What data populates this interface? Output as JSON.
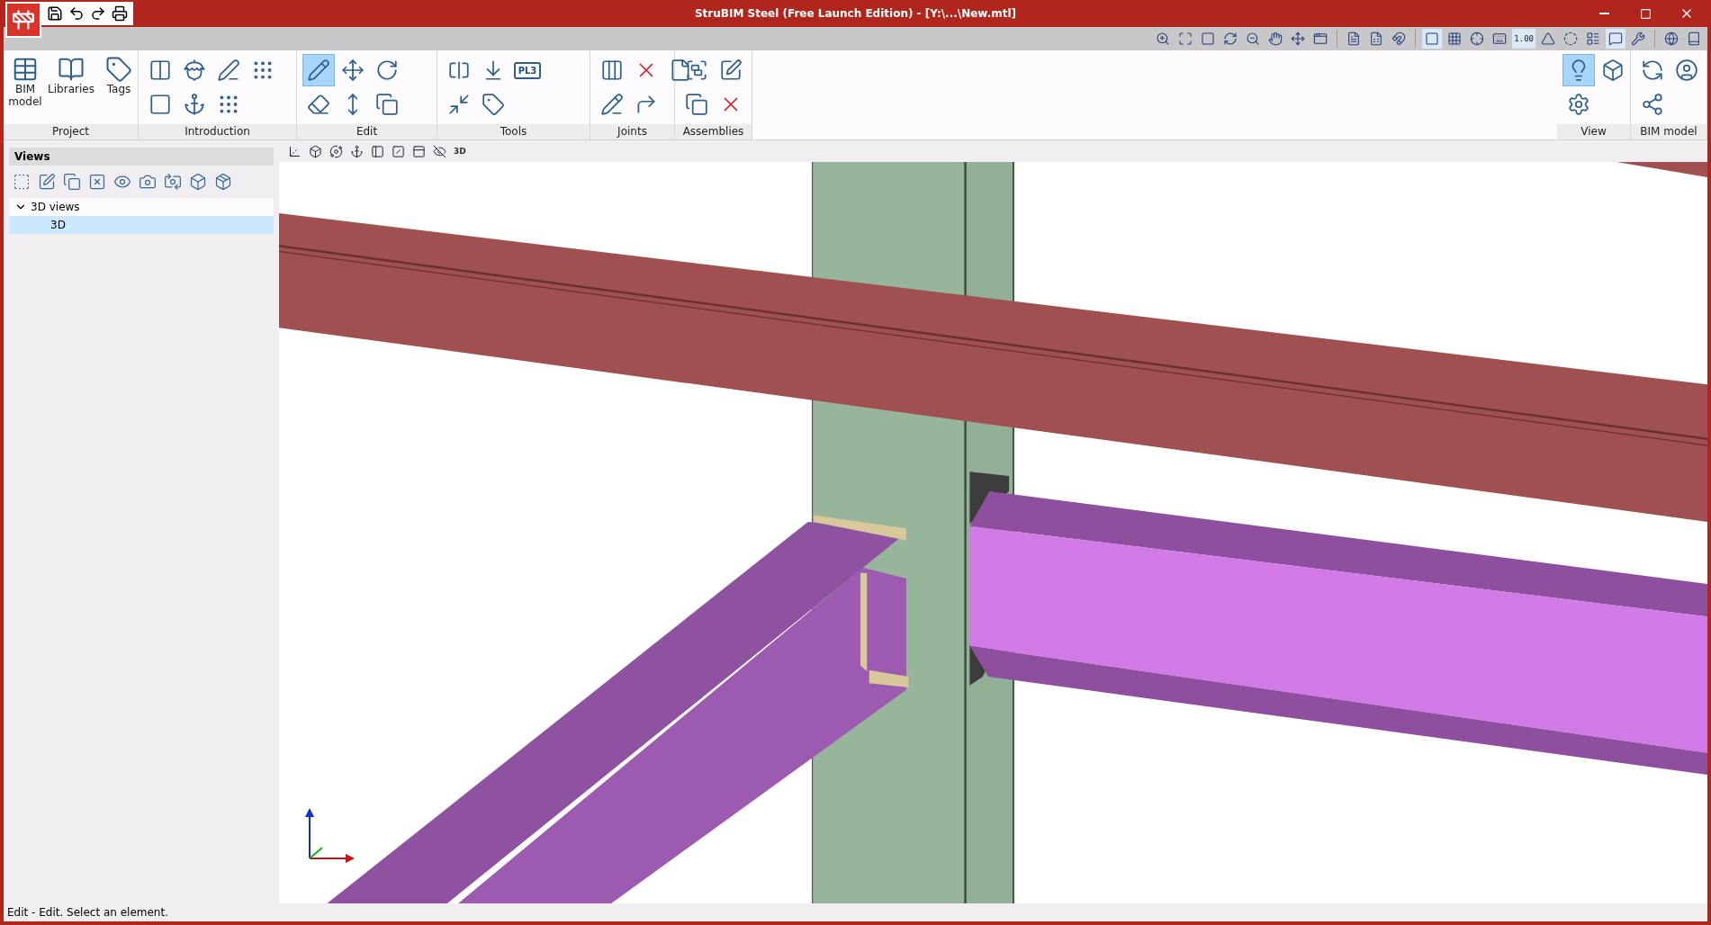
{
  "window": {
    "title": "StruBIM Steel (Free Launch Edition) - [Y:\\...\\New.mtl]"
  },
  "toolbar": {
    "buttons": [
      {
        "selected": false
      },
      {
        "selected": false
      },
      {
        "selected": false
      },
      {
        "selected": false
      },
      {
        "selected": false
      },
      {
        "selected": false
      },
      {
        "selected": false
      },
      {
        "selected": false
      },
      {
        "selected": false
      },
      {
        "selected": false
      },
      {
        "selected": false
      },
      {
        "selected": true
      },
      {
        "selected": false
      },
      {
        "selected": false
      },
      {
        "selected": false
      },
      {
        "selected": true,
        "text": "1.00"
      },
      {
        "selected": false
      },
      {
        "selected": false
      },
      {
        "selected": false
      },
      {
        "selected": true
      },
      {
        "selected": false
      },
      {
        "selected": false
      },
      {
        "selected": false
      }
    ]
  },
  "ribbon": {
    "groups": [
      {
        "label": "Project",
        "tools": [
          {
            "label": "BIM model",
            "selected": false
          },
          {
            "label": "Libraries",
            "selected": false
          },
          {
            "label": "Tags",
            "selected": false
          }
        ]
      },
      {
        "label": "Introduction",
        "tools": [
          {
            "selected": false
          },
          {
            "selected": false
          },
          {
            "selected": false
          },
          {
            "selected": false
          },
          {
            "selected": false
          },
          {
            "selected": false
          },
          {
            "selected": false
          }
        ]
      },
      {
        "label": "Edit",
        "tools": [
          {
            "selected": true
          },
          {
            "selected": false
          },
          {
            "selected": false
          },
          {
            "selected": false
          },
          {
            "selected": false
          },
          {
            "selected": false
          }
        ]
      },
      {
        "label": "Tools",
        "tools": [
          {
            "selected": false
          },
          {
            "selected": false
          },
          {
            "selected": false
          },
          {
            "selected": false
          },
          {
            "selected": false,
            "text": "PL3"
          }
        ]
      },
      {
        "label": "Joints",
        "tools": [
          {
            "selected": false
          },
          {
            "selected": false
          },
          {
            "selected": false
          },
          {
            "selected": false
          },
          {
            "selected": false
          }
        ]
      },
      {
        "label": "Assemblies",
        "tools": [
          {
            "selected": false
          },
          {
            "selected": false
          },
          {
            "selected": false
          },
          {
            "selected": false
          }
        ]
      },
      {
        "label": "View",
        "tools": [
          {
            "selected": true
          },
          {
            "selected": false
          },
          {
            "selected": false
          }
        ]
      },
      {
        "label": "BIM model",
        "tools": [
          {
            "selected": false
          },
          {
            "selected": false
          },
          {
            "selected": false
          }
        ]
      }
    ]
  },
  "views_panel": {
    "title": "Views",
    "tree": [
      {
        "label": "3D views",
        "expanded": true,
        "selected": false,
        "children": [
          {
            "label": "3D",
            "selected": true
          }
        ]
      }
    ]
  },
  "viewport_toolbar": {
    "icon_text": "3D"
  },
  "status_bar": {
    "text": "Edit - Edit. Select an element."
  }
}
